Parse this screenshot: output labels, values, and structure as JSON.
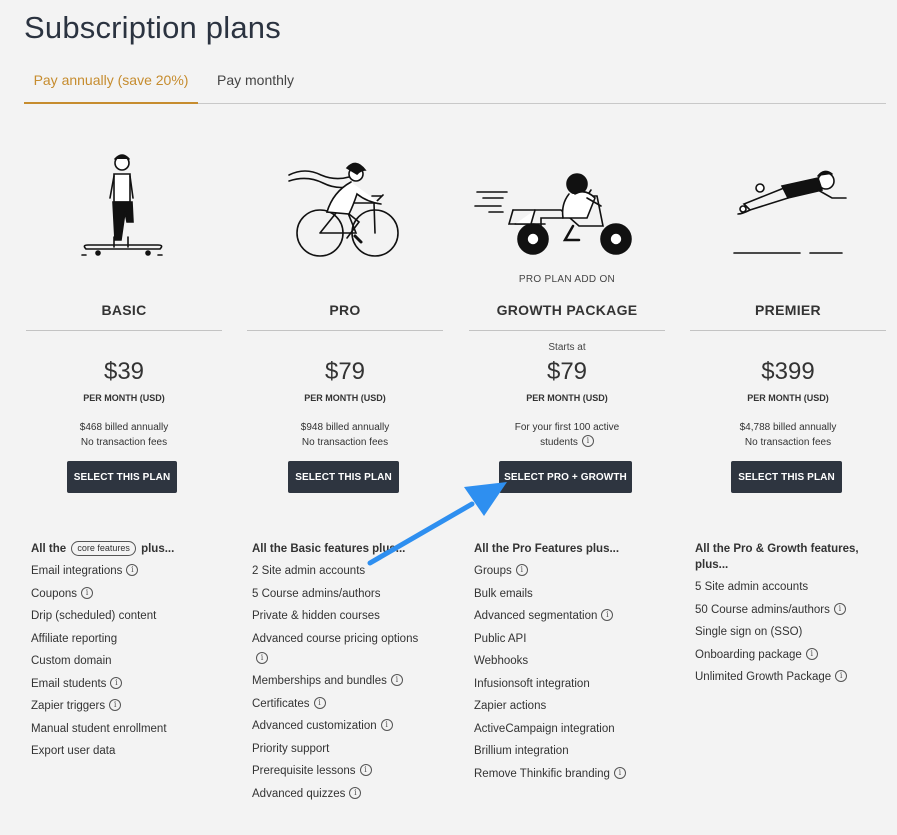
{
  "page": {
    "title": "Subscription plans"
  },
  "tabs": [
    {
      "label": "Pay annually (save 20%)"
    },
    {
      "label": "Pay monthly"
    }
  ],
  "colors": {
    "accent": "#c68c2e",
    "button": "#2e3540",
    "arrow": "#2e8ff0"
  },
  "plans": [
    {
      "name": "BASIC",
      "price": "$39",
      "period": "PER MONTH (USD)",
      "billed": "$468 billed annually",
      "note": "No transaction fees",
      "button": "SELECT THIS PLAN",
      "illustration": "skateboarder-illustration",
      "features_head_pre": "All the",
      "features_head_pill": "core features",
      "features_head_post": "plus...",
      "features": [
        "Email integrations",
        "Coupons",
        "Drip (scheduled) content",
        "Affiliate reporting",
        "Custom domain",
        "Email students",
        "Zapier triggers",
        "Manual student enrollment",
        "Export user data"
      ]
    },
    {
      "name": "PRO",
      "price": "$79",
      "period": "PER MONTH (USD)",
      "billed": "$948 billed annually",
      "note": "No transaction fees",
      "button": "SELECT THIS PLAN",
      "illustration": "cyclist-illustration",
      "features_head": "All the Basic features plus...",
      "features": [
        "2 Site admin accounts",
        "5 Course admins/authors",
        "Private & hidden courses",
        "Advanced course pricing options",
        "Memberships and bundles",
        "Certificates",
        "Advanced customization",
        "Priority support",
        "Prerequisite lessons",
        "Advanced quizzes"
      ]
    },
    {
      "eyebrow": "PRO PLAN ADD ON",
      "name": "GROWTH PACKAGE",
      "starts": "Starts at",
      "price": "$79",
      "period": "PER MONTH (USD)",
      "billed": "For your first 100 active",
      "note": "students",
      "button": "SELECT PRO + GROWTH",
      "illustration": "motorcyclist-illustration",
      "features_head": "All the Pro Features plus...",
      "features": [
        "Groups",
        "Bulk emails",
        "Advanced segmentation",
        "Public API",
        "Webhooks",
        "Infusionsoft integration",
        "Zapier actions",
        "ActiveCampaign integration",
        "Brillium integration",
        "Remove Thinkific branding"
      ]
    },
    {
      "name": "PREMIER",
      "price": "$399",
      "period": "PER MONTH (USD)",
      "billed": "$4,788 billed annually",
      "note": "No transaction fees",
      "button": "SELECT THIS PLAN",
      "illustration": "flying-person-illustration",
      "features_head": "All the Pro & Growth features, plus...",
      "features": [
        "5 Site admin accounts",
        "50 Course admins/authors",
        "Single sign on (SSO)",
        "Onboarding package",
        "Unlimited Growth Package"
      ]
    }
  ],
  "info_icon": "ⓘ"
}
